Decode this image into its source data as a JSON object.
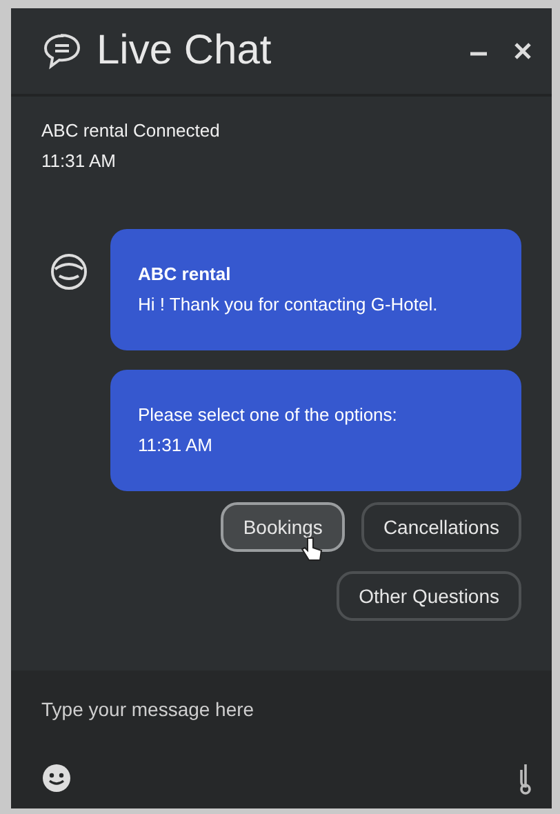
{
  "window": {
    "title": "Live Chat"
  },
  "status": {
    "text": "ABC rental Connected",
    "time": "11:31 AM"
  },
  "messages": [
    {
      "sender": "ABC rental",
      "text": "Hi ! Thank you for contacting G-Hotel.",
      "avatar": true
    },
    {
      "text": "Please select one of the options:",
      "time": "11:31 AM",
      "avatar": false
    }
  ],
  "options": [
    {
      "label": "Bookings",
      "highlighted": true
    },
    {
      "label": "Cancellations",
      "highlighted": false
    },
    {
      "label": "Other Questions",
      "highlighted": false
    }
  ],
  "composer": {
    "placeholder": "Type your message here"
  }
}
